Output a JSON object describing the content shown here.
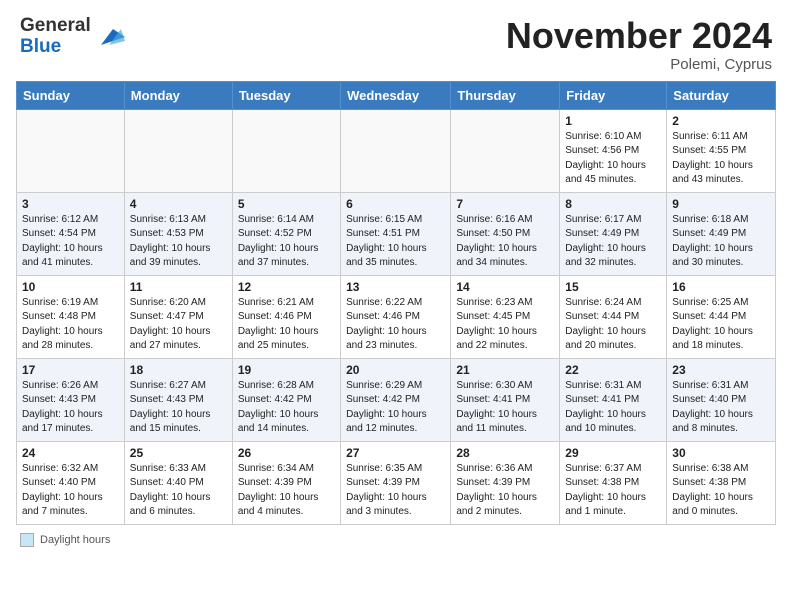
{
  "header": {
    "logo_line1": "General",
    "logo_line2": "Blue",
    "month_title": "November 2024",
    "location": "Polemi, Cyprus"
  },
  "days_of_week": [
    "Sunday",
    "Monday",
    "Tuesday",
    "Wednesday",
    "Thursday",
    "Friday",
    "Saturday"
  ],
  "weeks": [
    [
      {
        "day": "",
        "info": ""
      },
      {
        "day": "",
        "info": ""
      },
      {
        "day": "",
        "info": ""
      },
      {
        "day": "",
        "info": ""
      },
      {
        "day": "",
        "info": ""
      },
      {
        "day": "1",
        "info": "Sunrise: 6:10 AM\nSunset: 4:56 PM\nDaylight: 10 hours and 45 minutes."
      },
      {
        "day": "2",
        "info": "Sunrise: 6:11 AM\nSunset: 4:55 PM\nDaylight: 10 hours and 43 minutes."
      }
    ],
    [
      {
        "day": "3",
        "info": "Sunrise: 6:12 AM\nSunset: 4:54 PM\nDaylight: 10 hours and 41 minutes."
      },
      {
        "day": "4",
        "info": "Sunrise: 6:13 AM\nSunset: 4:53 PM\nDaylight: 10 hours and 39 minutes."
      },
      {
        "day": "5",
        "info": "Sunrise: 6:14 AM\nSunset: 4:52 PM\nDaylight: 10 hours and 37 minutes."
      },
      {
        "day": "6",
        "info": "Sunrise: 6:15 AM\nSunset: 4:51 PM\nDaylight: 10 hours and 35 minutes."
      },
      {
        "day": "7",
        "info": "Sunrise: 6:16 AM\nSunset: 4:50 PM\nDaylight: 10 hours and 34 minutes."
      },
      {
        "day": "8",
        "info": "Sunrise: 6:17 AM\nSunset: 4:49 PM\nDaylight: 10 hours and 32 minutes."
      },
      {
        "day": "9",
        "info": "Sunrise: 6:18 AM\nSunset: 4:49 PM\nDaylight: 10 hours and 30 minutes."
      }
    ],
    [
      {
        "day": "10",
        "info": "Sunrise: 6:19 AM\nSunset: 4:48 PM\nDaylight: 10 hours and 28 minutes."
      },
      {
        "day": "11",
        "info": "Sunrise: 6:20 AM\nSunset: 4:47 PM\nDaylight: 10 hours and 27 minutes."
      },
      {
        "day": "12",
        "info": "Sunrise: 6:21 AM\nSunset: 4:46 PM\nDaylight: 10 hours and 25 minutes."
      },
      {
        "day": "13",
        "info": "Sunrise: 6:22 AM\nSunset: 4:46 PM\nDaylight: 10 hours and 23 minutes."
      },
      {
        "day": "14",
        "info": "Sunrise: 6:23 AM\nSunset: 4:45 PM\nDaylight: 10 hours and 22 minutes."
      },
      {
        "day": "15",
        "info": "Sunrise: 6:24 AM\nSunset: 4:44 PM\nDaylight: 10 hours and 20 minutes."
      },
      {
        "day": "16",
        "info": "Sunrise: 6:25 AM\nSunset: 4:44 PM\nDaylight: 10 hours and 18 minutes."
      }
    ],
    [
      {
        "day": "17",
        "info": "Sunrise: 6:26 AM\nSunset: 4:43 PM\nDaylight: 10 hours and 17 minutes."
      },
      {
        "day": "18",
        "info": "Sunrise: 6:27 AM\nSunset: 4:43 PM\nDaylight: 10 hours and 15 minutes."
      },
      {
        "day": "19",
        "info": "Sunrise: 6:28 AM\nSunset: 4:42 PM\nDaylight: 10 hours and 14 minutes."
      },
      {
        "day": "20",
        "info": "Sunrise: 6:29 AM\nSunset: 4:42 PM\nDaylight: 10 hours and 12 minutes."
      },
      {
        "day": "21",
        "info": "Sunrise: 6:30 AM\nSunset: 4:41 PM\nDaylight: 10 hours and 11 minutes."
      },
      {
        "day": "22",
        "info": "Sunrise: 6:31 AM\nSunset: 4:41 PM\nDaylight: 10 hours and 10 minutes."
      },
      {
        "day": "23",
        "info": "Sunrise: 6:31 AM\nSunset: 4:40 PM\nDaylight: 10 hours and 8 minutes."
      }
    ],
    [
      {
        "day": "24",
        "info": "Sunrise: 6:32 AM\nSunset: 4:40 PM\nDaylight: 10 hours and 7 minutes."
      },
      {
        "day": "25",
        "info": "Sunrise: 6:33 AM\nSunset: 4:40 PM\nDaylight: 10 hours and 6 minutes."
      },
      {
        "day": "26",
        "info": "Sunrise: 6:34 AM\nSunset: 4:39 PM\nDaylight: 10 hours and 4 minutes."
      },
      {
        "day": "27",
        "info": "Sunrise: 6:35 AM\nSunset: 4:39 PM\nDaylight: 10 hours and 3 minutes."
      },
      {
        "day": "28",
        "info": "Sunrise: 6:36 AM\nSunset: 4:39 PM\nDaylight: 10 hours and 2 minutes."
      },
      {
        "day": "29",
        "info": "Sunrise: 6:37 AM\nSunset: 4:38 PM\nDaylight: 10 hours and 1 minute."
      },
      {
        "day": "30",
        "info": "Sunrise: 6:38 AM\nSunset: 4:38 PM\nDaylight: 10 hours and 0 minutes."
      }
    ]
  ],
  "footer": {
    "legend_label": "Daylight hours"
  }
}
